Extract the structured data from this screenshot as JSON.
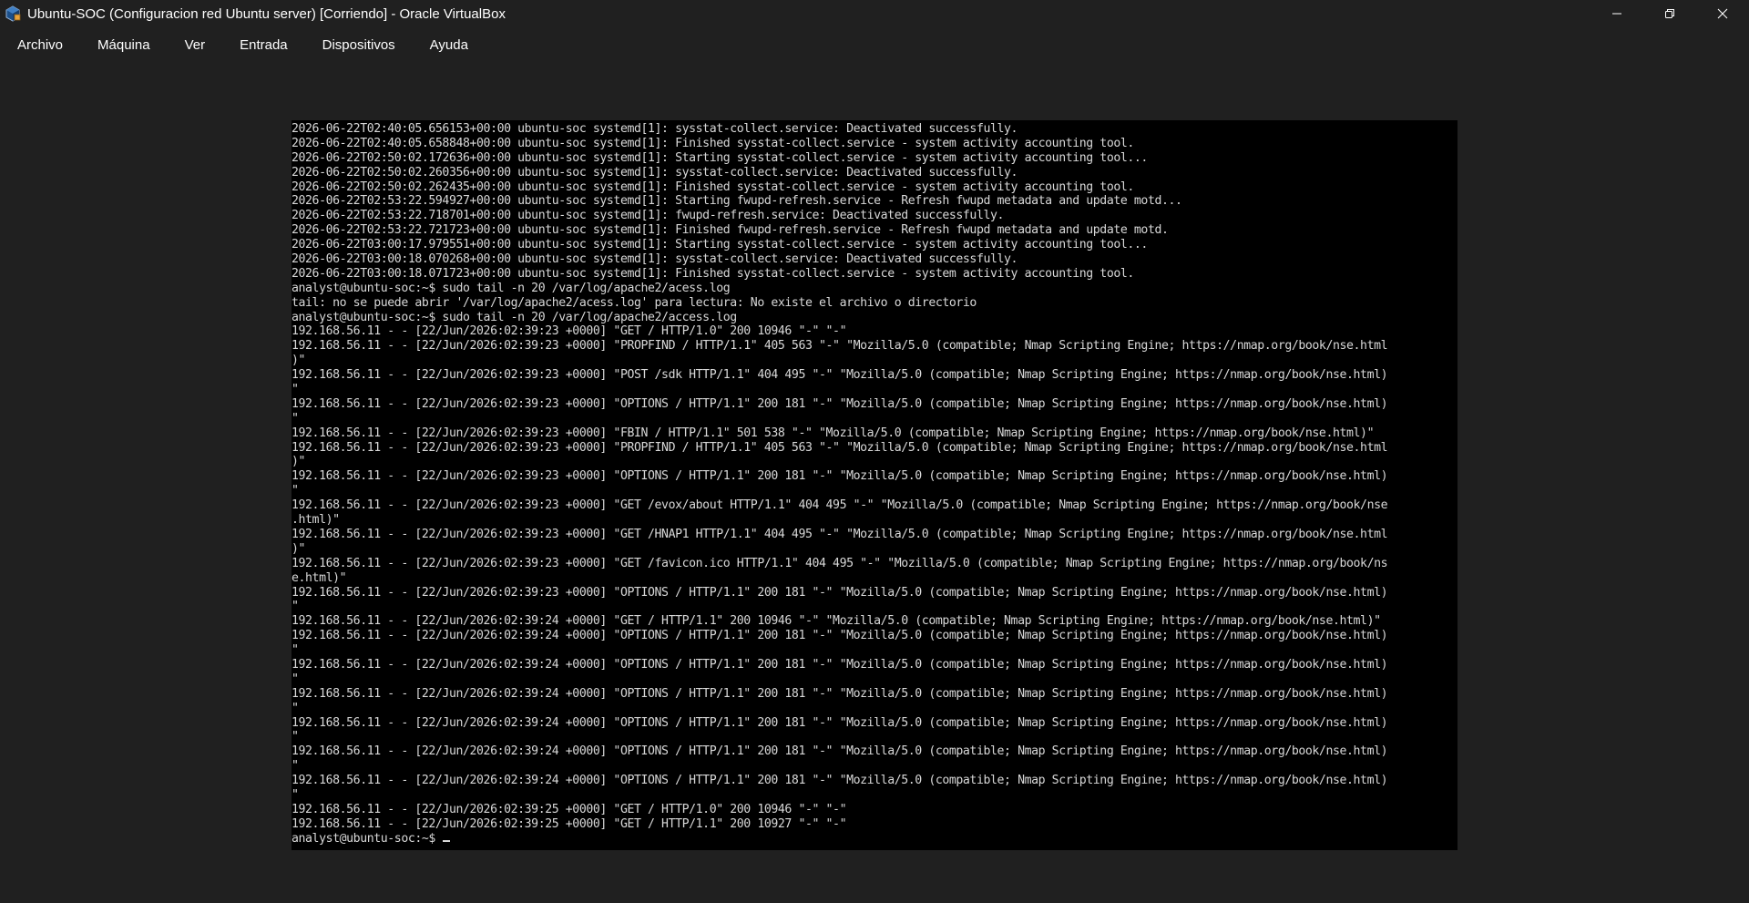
{
  "window": {
    "title": "Ubuntu-SOC (Configuracion red Ubuntu server) [Corriendo] - Oracle VirtualBox",
    "controls": {
      "minimize_icon": "minimize-icon",
      "restore_icon": "restore-icon",
      "close_icon": "close-icon"
    }
  },
  "menu": {
    "items": [
      {
        "label": "Archivo"
      },
      {
        "label": "Máquina"
      },
      {
        "label": "Ver"
      },
      {
        "label": "Entrada"
      },
      {
        "label": "Dispositivos"
      },
      {
        "label": "Ayuda"
      }
    ]
  },
  "terminal": {
    "lines": [
      "2026-06-22T02:40:05.656153+00:00 ubuntu-soc systemd[1]: sysstat-collect.service: Deactivated successfully.",
      "2026-06-22T02:40:05.658848+00:00 ubuntu-soc systemd[1]: Finished sysstat-collect.service - system activity accounting tool.",
      "2026-06-22T02:50:02.172636+00:00 ubuntu-soc systemd[1]: Starting sysstat-collect.service - system activity accounting tool...",
      "2026-06-22T02:50:02.260356+00:00 ubuntu-soc systemd[1]: sysstat-collect.service: Deactivated successfully.",
      "2026-06-22T02:50:02.262435+00:00 ubuntu-soc systemd[1]: Finished sysstat-collect.service - system activity accounting tool.",
      "2026-06-22T02:53:22.594927+00:00 ubuntu-soc systemd[1]: Starting fwupd-refresh.service - Refresh fwupd metadata and update motd...",
      "2026-06-22T02:53:22.718701+00:00 ubuntu-soc systemd[1]: fwupd-refresh.service: Deactivated successfully.",
      "2026-06-22T02:53:22.721723+00:00 ubuntu-soc systemd[1]: Finished fwupd-refresh.service - Refresh fwupd metadata and update motd.",
      "2026-06-22T03:00:17.979551+00:00 ubuntu-soc systemd[1]: Starting sysstat-collect.service - system activity accounting tool...",
      "2026-06-22T03:00:18.070268+00:00 ubuntu-soc systemd[1]: sysstat-collect.service: Deactivated successfully.",
      "2026-06-22T03:00:18.071723+00:00 ubuntu-soc systemd[1]: Finished sysstat-collect.service - system activity accounting tool.",
      "analyst@ubuntu-soc:~$ sudo tail -n 20 /var/log/apache2/acess.log",
      "tail: no se puede abrir '/var/log/apache2/acess.log' para lectura: No existe el archivo o directorio",
      "analyst@ubuntu-soc:~$ sudo tail -n 20 /var/log/apache2/access.log",
      "192.168.56.11 - - [22/Jun/2026:02:39:23 +0000] \"GET / HTTP/1.0\" 200 10946 \"-\" \"-\"",
      "192.168.56.11 - - [22/Jun/2026:02:39:23 +0000] \"PROPFIND / HTTP/1.1\" 405 563 \"-\" \"Mozilla/5.0 (compatible; Nmap Scripting Engine; https://nmap.org/book/nse.html",
      ")\"",
      "192.168.56.11 - - [22/Jun/2026:02:39:23 +0000] \"POST /sdk HTTP/1.1\" 404 495 \"-\" \"Mozilla/5.0 (compatible; Nmap Scripting Engine; https://nmap.org/book/nse.html)",
      "\"",
      "192.168.56.11 - - [22/Jun/2026:02:39:23 +0000] \"OPTIONS / HTTP/1.1\" 200 181 \"-\" \"Mozilla/5.0 (compatible; Nmap Scripting Engine; https://nmap.org/book/nse.html)",
      "\"",
      "192.168.56.11 - - [22/Jun/2026:02:39:23 +0000] \"FBIN / HTTP/1.1\" 501 538 \"-\" \"Mozilla/5.0 (compatible; Nmap Scripting Engine; https://nmap.org/book/nse.html)\"",
      "192.168.56.11 - - [22/Jun/2026:02:39:23 +0000] \"PROPFIND / HTTP/1.1\" 405 563 \"-\" \"Mozilla/5.0 (compatible; Nmap Scripting Engine; https://nmap.org/book/nse.html",
      ")\"",
      "192.168.56.11 - - [22/Jun/2026:02:39:23 +0000] \"OPTIONS / HTTP/1.1\" 200 181 \"-\" \"Mozilla/5.0 (compatible; Nmap Scripting Engine; https://nmap.org/book/nse.html)",
      "\"",
      "192.168.56.11 - - [22/Jun/2026:02:39:23 +0000] \"GET /evox/about HTTP/1.1\" 404 495 \"-\" \"Mozilla/5.0 (compatible; Nmap Scripting Engine; https://nmap.org/book/nse",
      ".html)\"",
      "192.168.56.11 - - [22/Jun/2026:02:39:23 +0000] \"GET /HNAP1 HTTP/1.1\" 404 495 \"-\" \"Mozilla/5.0 (compatible; Nmap Scripting Engine; https://nmap.org/book/nse.html",
      ")\"",
      "192.168.56.11 - - [22/Jun/2026:02:39:23 +0000] \"GET /favicon.ico HTTP/1.1\" 404 495 \"-\" \"Mozilla/5.0 (compatible; Nmap Scripting Engine; https://nmap.org/book/ns",
      "e.html)\"",
      "192.168.56.11 - - [22/Jun/2026:02:39:23 +0000] \"OPTIONS / HTTP/1.1\" 200 181 \"-\" \"Mozilla/5.0 (compatible; Nmap Scripting Engine; https://nmap.org/book/nse.html)",
      "\"",
      "192.168.56.11 - - [22/Jun/2026:02:39:24 +0000] \"GET / HTTP/1.1\" 200 10946 \"-\" \"Mozilla/5.0 (compatible; Nmap Scripting Engine; https://nmap.org/book/nse.html)\"",
      "192.168.56.11 - - [22/Jun/2026:02:39:24 +0000] \"OPTIONS / HTTP/1.1\" 200 181 \"-\" \"Mozilla/5.0 (compatible; Nmap Scripting Engine; https://nmap.org/book/nse.html)",
      "\"",
      "192.168.56.11 - - [22/Jun/2026:02:39:24 +0000] \"OPTIONS / HTTP/1.1\" 200 181 \"-\" \"Mozilla/5.0 (compatible; Nmap Scripting Engine; https://nmap.org/book/nse.html)",
      "\"",
      "192.168.56.11 - - [22/Jun/2026:02:39:24 +0000] \"OPTIONS / HTTP/1.1\" 200 181 \"-\" \"Mozilla/5.0 (compatible; Nmap Scripting Engine; https://nmap.org/book/nse.html)",
      "\"",
      "192.168.56.11 - - [22/Jun/2026:02:39:24 +0000] \"OPTIONS / HTTP/1.1\" 200 181 \"-\" \"Mozilla/5.0 (compatible; Nmap Scripting Engine; https://nmap.org/book/nse.html)",
      "\"",
      "192.168.56.11 - - [22/Jun/2026:02:39:24 +0000] \"OPTIONS / HTTP/1.1\" 200 181 \"-\" \"Mozilla/5.0 (compatible; Nmap Scripting Engine; https://nmap.org/book/nse.html)",
      "\"",
      "192.168.56.11 - - [22/Jun/2026:02:39:24 +0000] \"OPTIONS / HTTP/1.1\" 200 181 \"-\" \"Mozilla/5.0 (compatible; Nmap Scripting Engine; https://nmap.org/book/nse.html)",
      "\"",
      "192.168.56.11 - - [22/Jun/2026:02:39:25 +0000] \"GET / HTTP/1.0\" 200 10946 \"-\" \"-\"",
      "192.168.56.11 - - [22/Jun/2026:02:39:25 +0000] \"GET / HTTP/1.1\" 200 10927 \"-\" \"-\"",
      "analyst@ubuntu-soc:~$ "
    ],
    "colors": {
      "background": "#000000",
      "text": "#d8d8d8"
    }
  },
  "colors": {
    "chrome_background": "#202020",
    "chrome_text": "#ffffff"
  },
  "icons": {
    "app": "virtualbox-icon"
  }
}
